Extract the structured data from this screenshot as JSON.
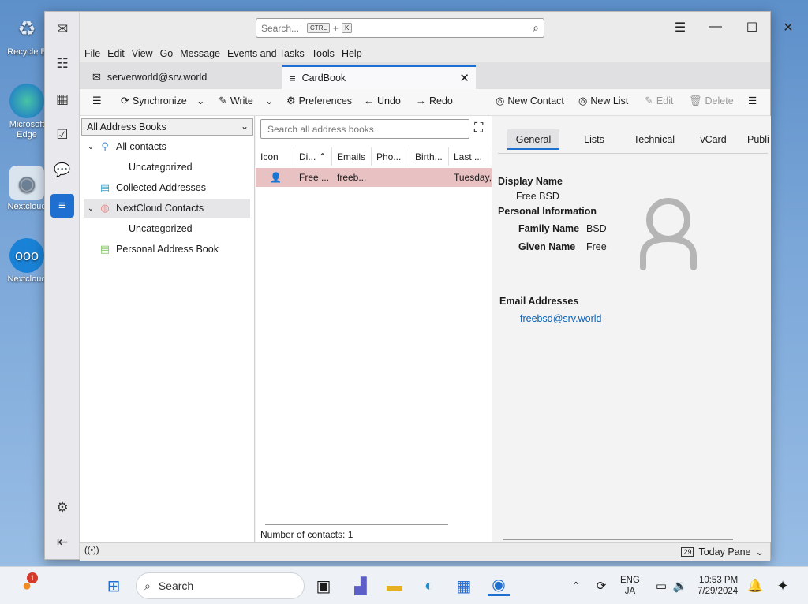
{
  "desktop": {
    "icons": [
      {
        "label": "Recycle B",
        "icon": "recycle-bin-icon"
      },
      {
        "label": "Microsoft Edge",
        "icon": "edge-icon"
      },
      {
        "label": "Nextcloud",
        "icon": "disc-icon"
      },
      {
        "label": "Nextcloud",
        "icon": "nextcloud-icon"
      }
    ]
  },
  "search": {
    "placeholder": "Search...",
    "shortcut_key1": "CTRL",
    "shortcut_plus": "+",
    "shortcut_key2": "K"
  },
  "menu": [
    "File",
    "Edit",
    "View",
    "Go",
    "Message",
    "Events and Tasks",
    "Tools",
    "Help"
  ],
  "tabs": [
    {
      "label": "serverworld@srv.world"
    },
    {
      "label": "CardBook"
    }
  ],
  "toolbar": {
    "synchronize": "Synchronize",
    "write": "Write",
    "preferences": "Preferences",
    "undo": "Undo",
    "redo": "Redo",
    "new_contact": "New Contact",
    "new_list": "New List",
    "edit": "Edit",
    "delete": "Delete"
  },
  "address_books": {
    "selector": "All Address Books",
    "items": [
      {
        "label": "All contacts"
      },
      {
        "label": "Uncategorized"
      },
      {
        "label": "Collected Addresses"
      },
      {
        "label": "NextCloud Contacts"
      },
      {
        "label": "Uncategorized"
      },
      {
        "label": "Personal Address Book"
      }
    ]
  },
  "contacts": {
    "search_placeholder": "Search all address books",
    "columns": [
      "Icon",
      "Di...",
      "Emails",
      "Pho...",
      "Birth...",
      "Last ..."
    ],
    "rows": [
      {
        "display": "Free ...",
        "email": "freeb...",
        "phone": "",
        "birth": "",
        "last": "Tuesday,"
      }
    ],
    "count_label": "Number of contacts: 1"
  },
  "detail": {
    "tabs": [
      "General",
      "Lists",
      "Technical",
      "vCard",
      "Publi"
    ],
    "display_name_label": "Display Name",
    "display_name": "Free BSD",
    "personal_info_label": "Personal Information",
    "family_name_label": "Family Name",
    "family_name": "BSD",
    "given_name_label": "Given Name",
    "given_name": "Free",
    "email_label": "Email Addresses",
    "email": "freebsd@srv.world"
  },
  "status": {
    "today_pane": "Today Pane",
    "calendar_day": "29"
  },
  "taskbar": {
    "search": "Search",
    "notification_badge": "1",
    "lang1": "ENG",
    "lang2": "JA",
    "time": "10:53 PM",
    "date": "7/29/2024"
  },
  "colors": {
    "accent": "#1f6fd1",
    "selected_row": "#e8c1c2",
    "link": "#0b5fb3"
  }
}
